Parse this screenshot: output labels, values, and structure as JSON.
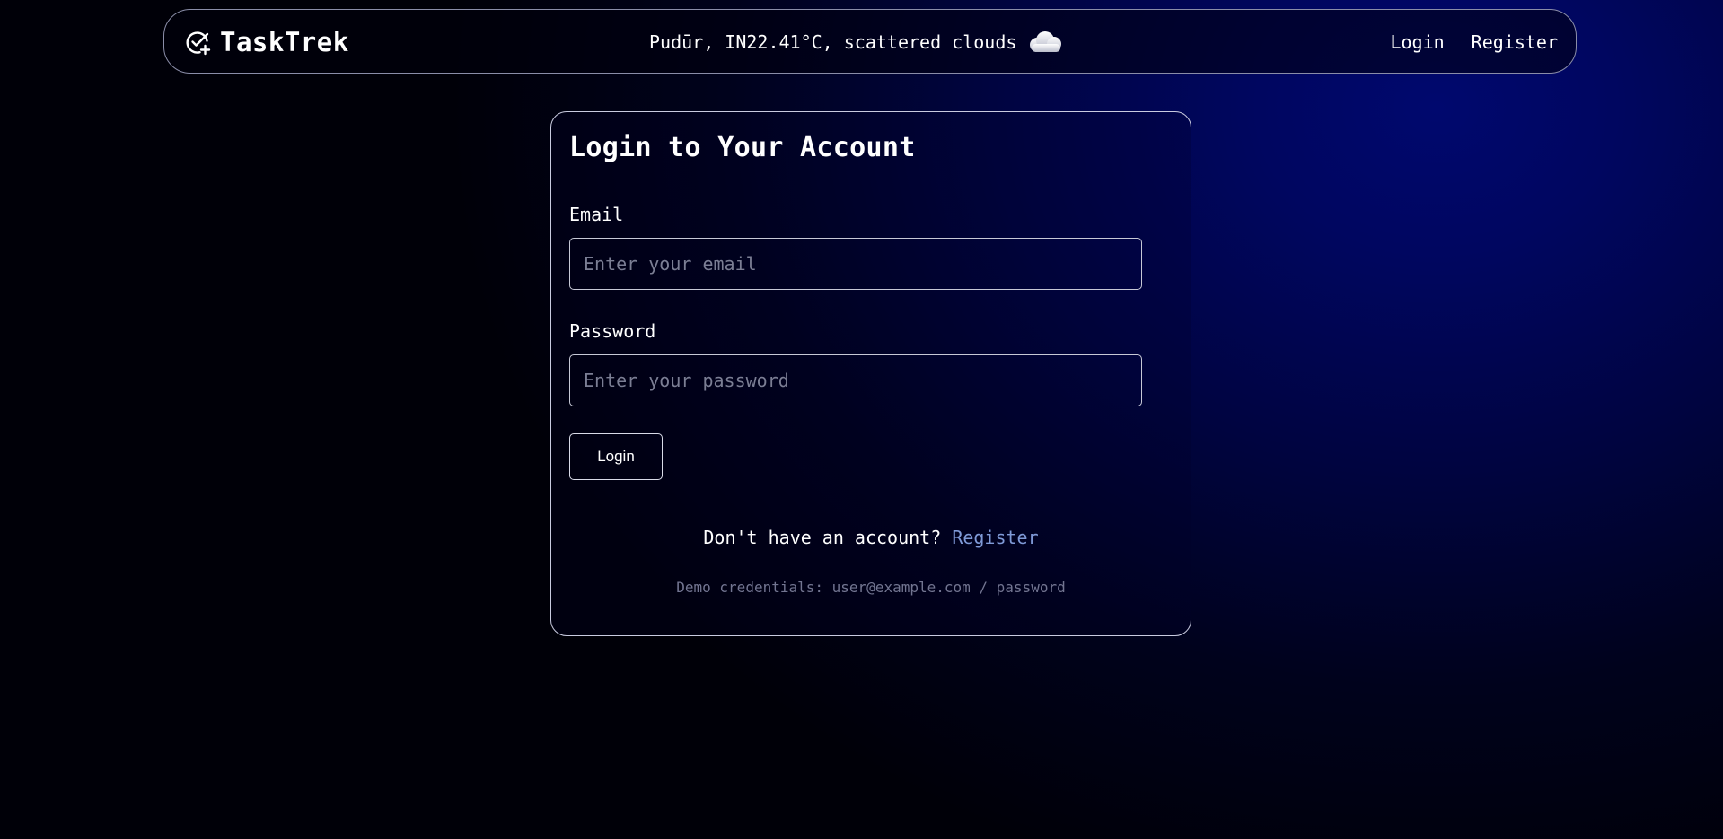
{
  "navbar": {
    "brand_name": "TaskTrek",
    "brand_icon": "check-circle-plus-icon",
    "weather": {
      "text": "Pudūr, IN22.41°C, scattered clouds",
      "icon": "cloud-icon"
    },
    "links": {
      "login": "Login",
      "register": "Register"
    }
  },
  "login_card": {
    "title": "Login to Your Account",
    "email_label": "Email",
    "email_placeholder": "Enter your email",
    "email_value": "",
    "password_label": "Password",
    "password_placeholder": "Enter your password",
    "password_value": "",
    "submit_label": "Login",
    "register_prompt": "Don't have an account?",
    "register_link": "Register",
    "demo_credentials": "Demo credentials: user@example.com / password"
  },
  "colors": {
    "background_dark": "#000008",
    "background_accent": "#00086e",
    "text": "#ffffff",
    "link": "#7f9ad8",
    "muted": "#727591",
    "border": "#c9cbe0"
  }
}
